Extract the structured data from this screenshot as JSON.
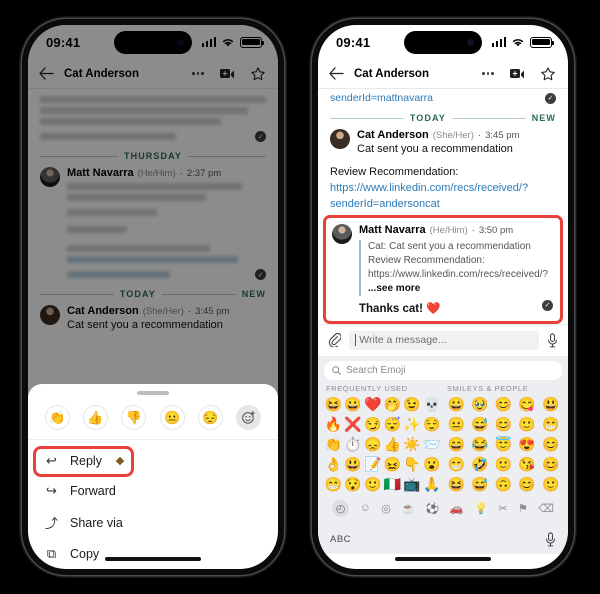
{
  "phones": {
    "left": {
      "status": {
        "time": "09:41"
      },
      "nav": {
        "title": "Cat Anderson",
        "back": "back-arrow",
        "more": "more-options",
        "video": "video-call",
        "star": "star"
      },
      "separators": {
        "thursday": "THURSDAY",
        "today": "TODAY",
        "new": "NEW"
      },
      "messages": [
        {
          "name": "Matt Navarra",
          "pronouns": "(He/Him)",
          "time": "2:37 pm",
          "redacted": true
        },
        {
          "name": "Cat Anderson",
          "pronouns": "(She/Her)",
          "time": "3:45 pm",
          "body": "Cat sent you a recommendation"
        }
      ],
      "sheet": {
        "reactions": [
          {
            "name": "clap-reaction",
            "glyph": "👏"
          },
          {
            "name": "thumbs-up-reaction",
            "glyph": "👍"
          },
          {
            "name": "thumbs-down-reaction",
            "glyph": "👎"
          },
          {
            "name": "neutral-face-reaction",
            "glyph": "😐"
          },
          {
            "name": "sad-face-reaction",
            "glyph": "😔"
          },
          {
            "name": "add-reaction",
            "glyph": "☺"
          }
        ],
        "menu": [
          {
            "label": "Reply",
            "icon": "↩",
            "highlighted": true,
            "has_badge": true
          },
          {
            "label": "Forward",
            "icon": "↪",
            "highlighted": false,
            "has_badge": false
          },
          {
            "label": "Share via",
            "icon": "⤴",
            "highlighted": false,
            "has_badge": false
          },
          {
            "label": "Copy",
            "icon": "⧉",
            "highlighted": false,
            "has_badge": false
          }
        ]
      }
    },
    "right": {
      "status": {
        "time": "09:41"
      },
      "nav": {
        "title": "Cat Anderson"
      },
      "top_link": "senderId=mattnavarra",
      "separators": {
        "today": "TODAY",
        "new": "NEW"
      },
      "messages": [
        {
          "name": "Cat Anderson",
          "pronouns": "(She/Her)",
          "time": "3:45 pm",
          "body": "Cat sent you a recommendation",
          "extra_label": "Review Recommendation:",
          "link1": "https://www.linkedin.com/recs/received/?",
          "link2": "senderId=andersoncat"
        }
      ],
      "highlighted_message": {
        "name": "Matt Navarra",
        "pronouns": "(He/Him)",
        "time": "3:50 pm",
        "quote": "Cat: Cat sent you a recommendation  Review Recommendation: https://www.linkedin.com/recs/received/?",
        "see_more": "...see more",
        "reply_text": "Thanks cat!",
        "reply_emoji": "❤️"
      },
      "composer": {
        "placeholder": "Write a message...",
        "attach": "attachment-icon",
        "mic": "microphone-icon"
      },
      "keyboard": {
        "search_placeholder": "Search Emoji",
        "section_left": "FREQUENTLY USED",
        "section_right": "SMILEYS & PEOPLE",
        "frequently_used": [
          "😆",
          "😀",
          "❤️",
          "🤭",
          "😉",
          "💀",
          "🔥",
          "❌",
          "😏",
          "😴",
          "✨",
          "😌",
          "👏",
          "⏱️",
          "😞",
          "👍",
          "☀️",
          "📨",
          "👌",
          "😃",
          "📝",
          "😖",
          "👇",
          "😮",
          "😁",
          "😯",
          "🙂",
          "🇮🇹",
          "📺",
          "🙏"
        ],
        "smileys": [
          "😀",
          "🥹",
          "😊",
          "😋",
          "😃",
          "😐",
          "😅",
          "😊",
          "🙂",
          "😁",
          "😄",
          "😂",
          "😇",
          "😍",
          "😊",
          "😁",
          "🤣",
          "🙂",
          "😘",
          "😊",
          "😆",
          "😅",
          "🙃",
          "😊",
          "🙂"
        ],
        "categories": [
          {
            "name": "recent-emoji-tab",
            "glyph": "◴",
            "active": true
          },
          {
            "name": "smileys-emoji-tab",
            "glyph": "☺",
            "active": false
          },
          {
            "name": "animals-emoji-tab",
            "glyph": "◎",
            "active": false
          },
          {
            "name": "food-emoji-tab",
            "glyph": "☕",
            "active": false
          },
          {
            "name": "activity-emoji-tab",
            "glyph": "⚽",
            "active": false
          },
          {
            "name": "travel-emoji-tab",
            "glyph": "🚗",
            "active": false
          },
          {
            "name": "objects-emoji-tab",
            "glyph": "💡",
            "active": false
          },
          {
            "name": "symbols-emoji-tab",
            "glyph": "✂",
            "active": false
          },
          {
            "name": "flags-emoji-tab",
            "glyph": "⚑",
            "active": false
          },
          {
            "name": "backspace-key",
            "glyph": "⌫",
            "active": false
          }
        ],
        "abc_key": "ABC"
      }
    }
  },
  "colors": {
    "highlight_red": "#e8403a",
    "link_blue": "#2b7bba",
    "separator_green": "#2b6a53",
    "keyboard_bg": "#eceef1"
  }
}
